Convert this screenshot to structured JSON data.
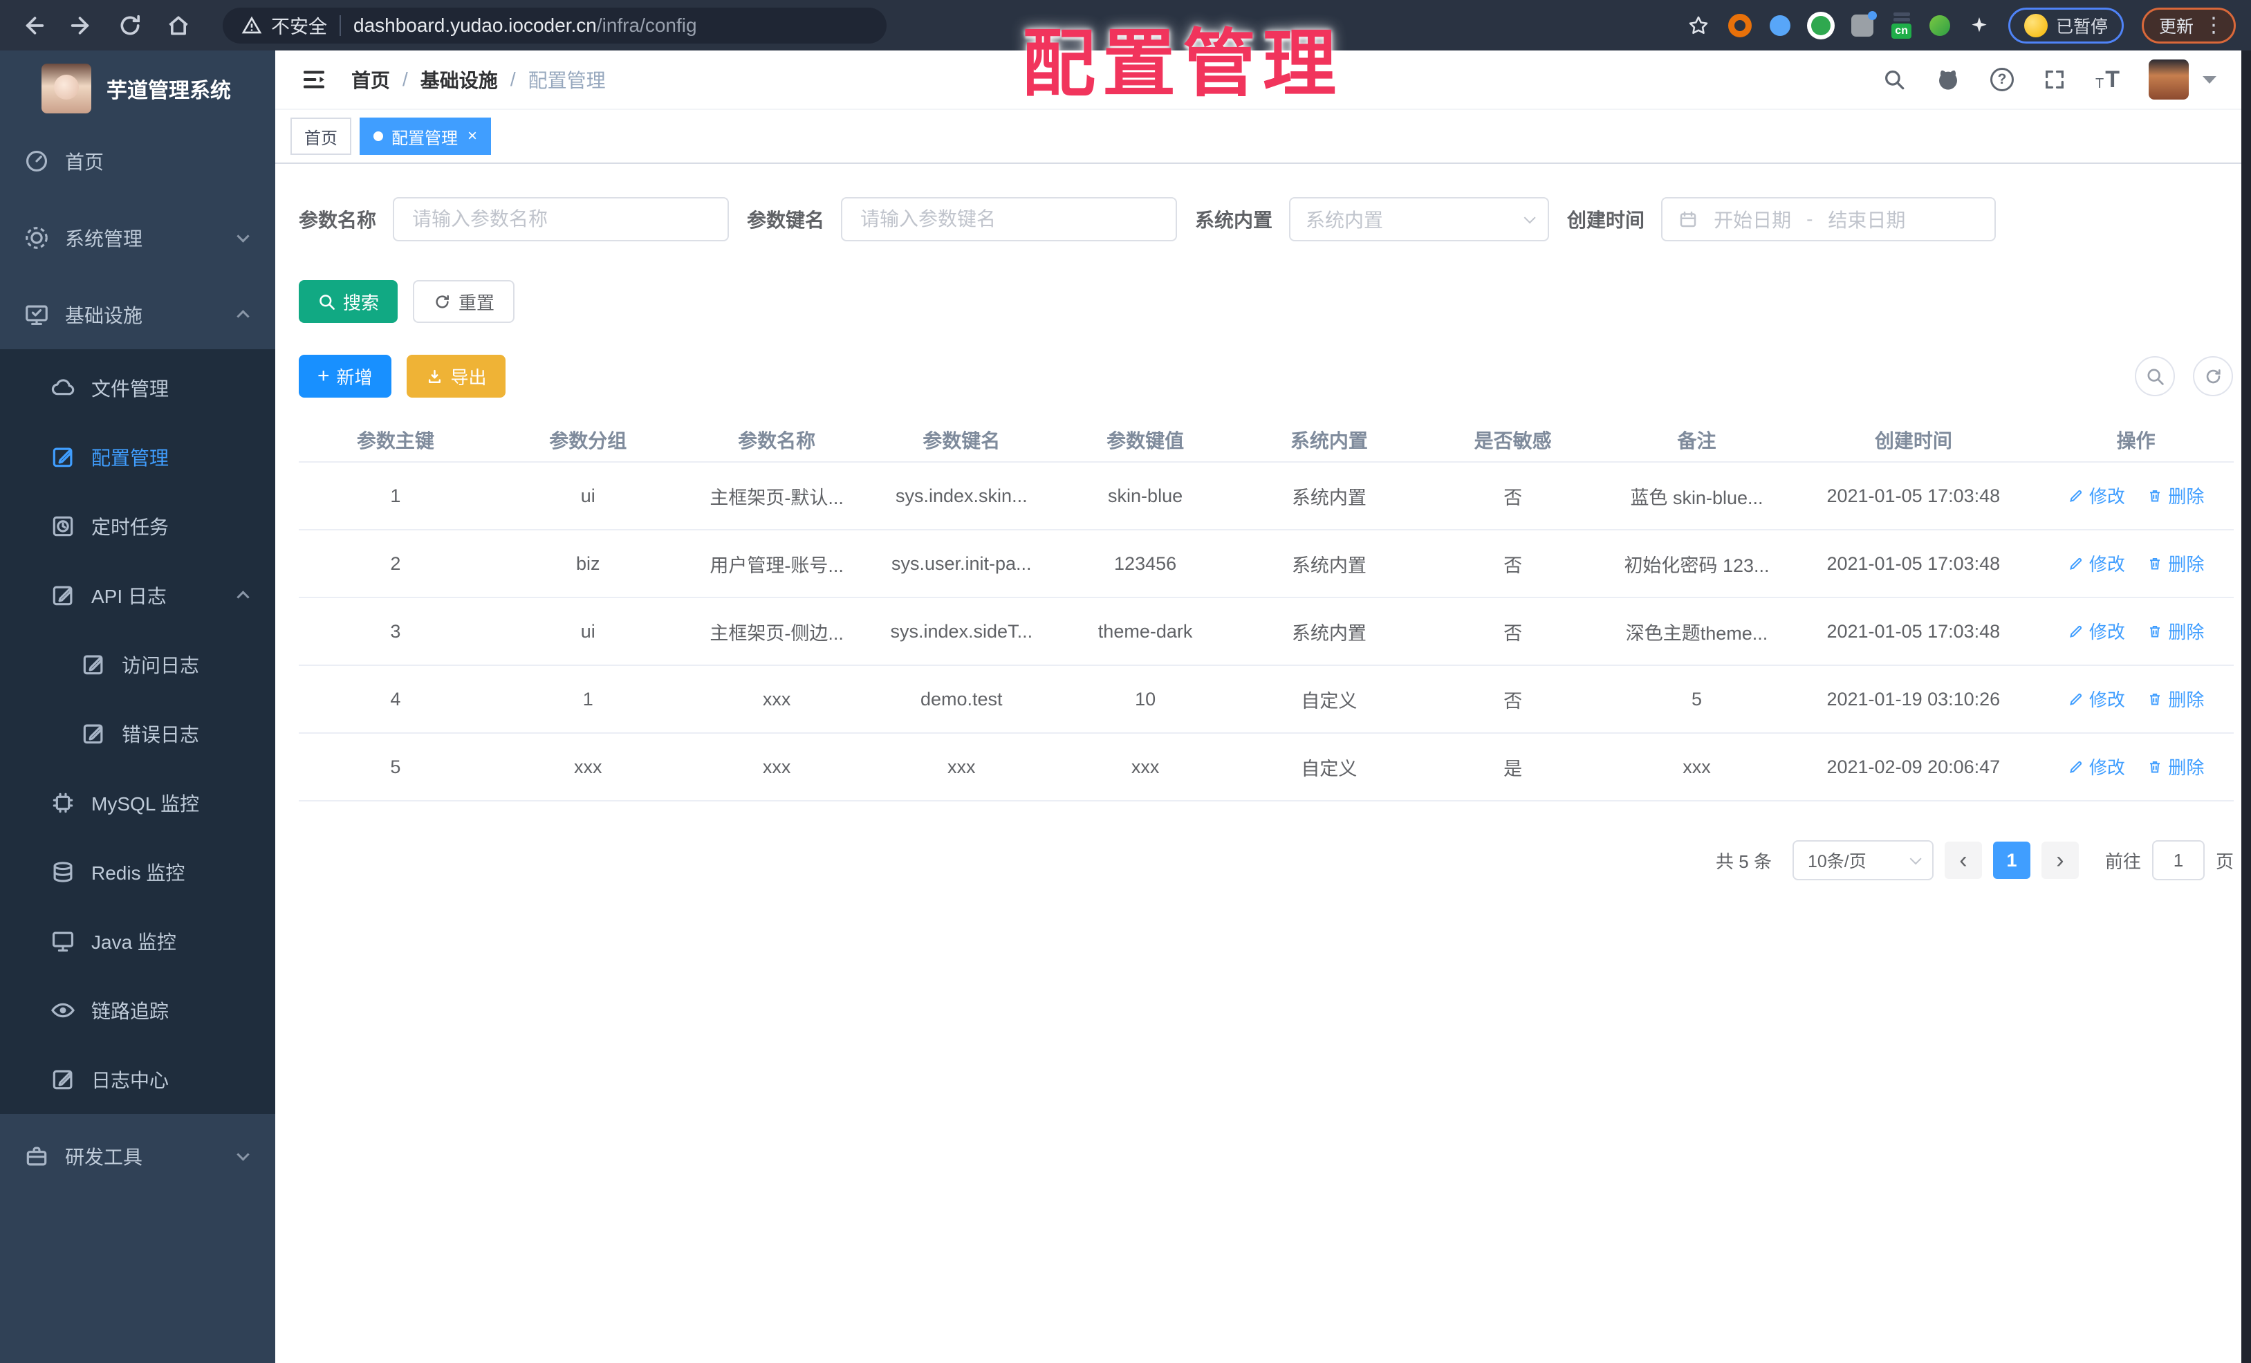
{
  "browser": {
    "security_label": "不安全",
    "url_host": "dashboard.yudao.iocoder.cn",
    "url_path": "/infra/config",
    "cn_badge": "cn",
    "paused_label": "已暂停",
    "update_label": "更新"
  },
  "watermark": "配置管理",
  "sidebar": {
    "title": "芋道管理系统",
    "items": {
      "home": "首页",
      "system": "系统管理",
      "infra": "基础设施",
      "file": "文件管理",
      "config": "配置管理",
      "job": "定时任务",
      "apilog": "API 日志",
      "accesslog": "访问日志",
      "errorlog": "错误日志",
      "mysql": "MySQL 监控",
      "redis": "Redis 监控",
      "java": "Java 监控",
      "trace": "链路追踪",
      "logcenter": "日志中心",
      "devtools": "研发工具"
    }
  },
  "header": {
    "breadcrumb": [
      "首页",
      "基础设施",
      "配置管理"
    ],
    "separator": "/"
  },
  "tabs": {
    "home": "首页",
    "config": "配置管理"
  },
  "filters": {
    "name_label": "参数名称",
    "name_placeholder": "请输入参数名称",
    "key_label": "参数键名",
    "key_placeholder": "请输入参数键名",
    "type_label": "系统内置",
    "type_placeholder": "系统内置",
    "date_label": "创建时间",
    "date_start": "开始日期",
    "date_separator": "-",
    "date_end": "结束日期"
  },
  "toolbar": {
    "search": "搜索",
    "reset": "重置",
    "add": "新增",
    "export": "导出"
  },
  "table": {
    "columns": [
      "参数主键",
      "参数分组",
      "参数名称",
      "参数键名",
      "参数键值",
      "系统内置",
      "是否敏感",
      "备注",
      "创建时间",
      "操作"
    ],
    "edit_label": "修改",
    "delete_label": "删除",
    "rows": [
      {
        "cells": [
          "1",
          "ui",
          "主框架页-默认...",
          "sys.index.skin...",
          "skin-blue",
          "系统内置",
          "否",
          "蓝色 skin-blue...",
          "2021-01-05 17:03:48"
        ]
      },
      {
        "cells": [
          "2",
          "biz",
          "用户管理-账号...",
          "sys.user.init-pa...",
          "123456",
          "系统内置",
          "否",
          "初始化密码 123...",
          "2021-01-05 17:03:48"
        ]
      },
      {
        "cells": [
          "3",
          "ui",
          "主框架页-侧边...",
          "sys.index.sideT...",
          "theme-dark",
          "系统内置",
          "否",
          "深色主题theme...",
          "2021-01-05 17:03:48"
        ]
      },
      {
        "cells": [
          "4",
          "1",
          "xxx",
          "demo.test",
          "10",
          "自定义",
          "否",
          "5",
          "2021-01-19 03:10:26"
        ]
      },
      {
        "cells": [
          "5",
          "xxx",
          "xxx",
          "xxx",
          "xxx",
          "自定义",
          "是",
          "xxx",
          "2021-02-09 20:06:47"
        ]
      }
    ]
  },
  "pagination": {
    "total": "共 5 条",
    "page_size": "10条/页",
    "current_page": "1",
    "goto_label": "前往",
    "goto_value": "1",
    "page_unit": "页"
  },
  "colors": {
    "accent": "#409eff",
    "add_button": "#1890ff",
    "search_button": "#11a983",
    "export_button": "#efb336",
    "watermark": "#f1345c",
    "sidebar_bg": "#304156",
    "submenu_bg": "#1f2d3d",
    "browser_bar_bg": "#2a3342"
  }
}
